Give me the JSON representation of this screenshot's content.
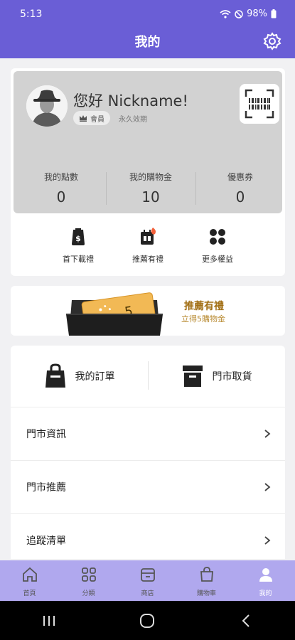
{
  "status_bar": {
    "time": "5:13",
    "battery": "98%"
  },
  "header": {
    "title": "我的"
  },
  "profile": {
    "greeting": "您好 Nickname!",
    "member_badge": "會員",
    "validity": "永久效期",
    "stats": [
      {
        "label": "我的點數",
        "value": "0"
      },
      {
        "label": "我的購物金",
        "value": "10"
      },
      {
        "label": "優惠券",
        "value": "0"
      }
    ],
    "quick_actions": [
      {
        "label": "首下載禮",
        "icon": "dollar-bag-icon"
      },
      {
        "label": "推薦有禮",
        "icon": "gift-calendar-icon"
      },
      {
        "label": "更多權益",
        "icon": "grid-icon"
      }
    ]
  },
  "banner": {
    "badge_number": "5",
    "title": "推薦有禮",
    "subtitle": "立得5購物金"
  },
  "orders": [
    {
      "label": "我的訂單",
      "icon": "shopping-bag-icon"
    },
    {
      "label": "門市取貨",
      "icon": "store-box-icon"
    }
  ],
  "menu": [
    {
      "label": "門市資訊"
    },
    {
      "label": "門市推薦"
    },
    {
      "label": "追蹤清單"
    }
  ],
  "tabbar": [
    {
      "label": "首頁",
      "icon": "home-icon",
      "active": false
    },
    {
      "label": "分類",
      "icon": "categories-icon",
      "active": false
    },
    {
      "label": "商店",
      "icon": "store-icon",
      "active": false
    },
    {
      "label": "購物車",
      "icon": "cart-bag-icon",
      "active": false
    },
    {
      "label": "我的",
      "icon": "user-icon",
      "active": true
    }
  ],
  "colors": {
    "primary": "#6a5ed6",
    "tabbar": "#b0a8ee",
    "banner_accent": "#a26f15"
  }
}
